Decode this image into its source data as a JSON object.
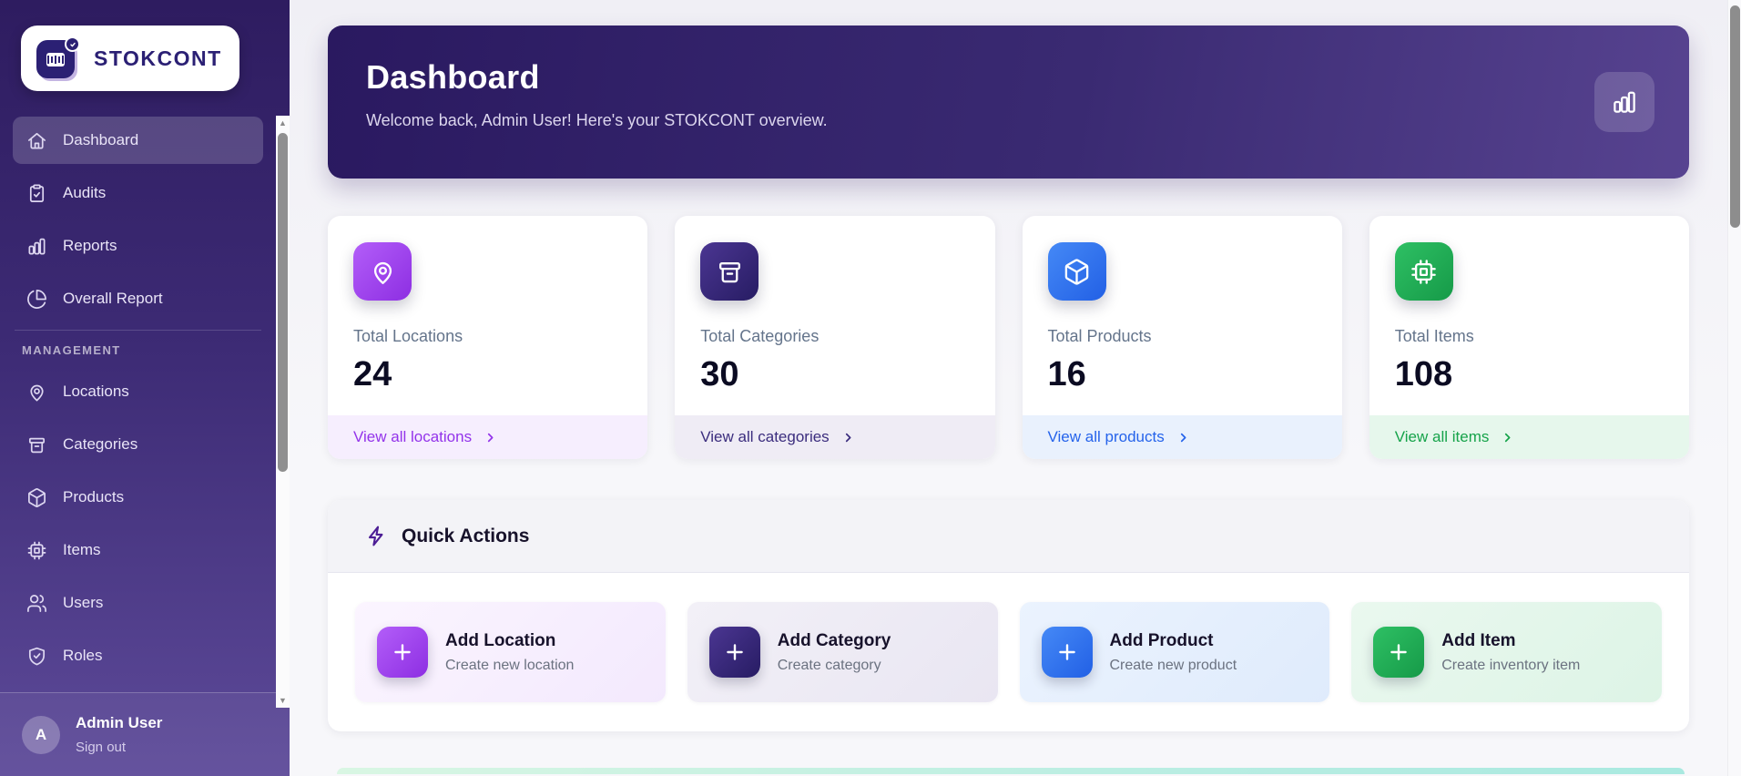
{
  "app": {
    "logo_text": "STOKCONT"
  },
  "sidebar": {
    "items": [
      {
        "label": "Dashboard",
        "icon": "home-icon",
        "active": true
      },
      {
        "label": "Audits",
        "icon": "clipboard-check-icon",
        "active": false
      },
      {
        "label": "Reports",
        "icon": "bar-chart-icon",
        "active": false
      },
      {
        "label": "Overall Report",
        "icon": "pie-chart-icon",
        "active": false
      }
    ],
    "management_label": "MANAGEMENT",
    "management_items": [
      {
        "label": "Locations",
        "icon": "map-pin-icon"
      },
      {
        "label": "Categories",
        "icon": "archive-icon"
      },
      {
        "label": "Products",
        "icon": "cube-icon"
      },
      {
        "label": "Items",
        "icon": "cpu-icon"
      },
      {
        "label": "Users",
        "icon": "users-icon"
      },
      {
        "label": "Roles",
        "icon": "shield-check-icon"
      }
    ],
    "user": {
      "initial": "A",
      "name": "Admin User",
      "signout_label": "Sign out"
    }
  },
  "header": {
    "title": "Dashboard",
    "subtitle": "Welcome back, Admin User! Here's your STOKCONT overview.",
    "icon": "bar-chart-icon",
    "background": "#2a1960",
    "background_right": "#574390"
  },
  "stats": [
    {
      "label": "Total Locations",
      "value": "24",
      "link_label": "View all locations",
      "icon": "map-pin-icon",
      "accent": "#9333ea",
      "footer_bg": "#f6eefe"
    },
    {
      "label": "Total Categories",
      "value": "30",
      "link_label": "View all categories",
      "icon": "archive-icon",
      "accent": "#3b2d7e",
      "footer_bg": "#efecf5"
    },
    {
      "label": "Total Products",
      "value": "16",
      "link_label": "View all products",
      "icon": "cube-icon",
      "accent": "#2563eb",
      "footer_bg": "#e9f1fd"
    },
    {
      "label": "Total Items",
      "value": "108",
      "link_label": "View all items",
      "icon": "cpu-icon",
      "accent": "#16a34a",
      "footer_bg": "#e6f7ec"
    }
  ],
  "quick_actions": {
    "title": "Quick Actions",
    "icon": "lightning-icon",
    "actions": [
      {
        "title": "Add Location",
        "subtitle": "Create new location",
        "icon": "plus-icon",
        "accent": "#9333ea"
      },
      {
        "title": "Add Category",
        "subtitle": "Create category",
        "icon": "plus-icon",
        "accent": "#2b2074"
      },
      {
        "title": "Add Product",
        "subtitle": "Create new product",
        "icon": "plus-icon",
        "accent": "#2563eb"
      },
      {
        "title": "Add Item",
        "subtitle": "Create inventory item",
        "icon": "plus-icon",
        "accent": "#16a34a"
      }
    ]
  }
}
